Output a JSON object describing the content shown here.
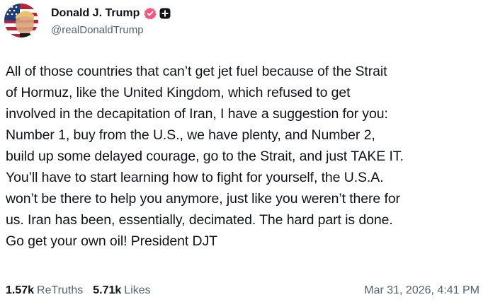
{
  "author": {
    "display_name": "Donald J. Trump",
    "handle": "@realDonaldTrump",
    "avatar_icon": "profile-photo-flag-avatar",
    "verified_icon": "verified-badge-icon",
    "verified_color": "#f6547c",
    "plus_icon": "plus-badge-icon"
  },
  "post": {
    "text": "All of those countries that can’t get jet fuel because of the Strait\nof Hormuz, like the United Kingdom, which refused to get\ninvolved in the decapitation of Iran, I have a suggestion for you:\nNumber 1, buy from the U.S., we have plenty, and Number 2,\nbuild up some delayed courage, go to the Strait, and just TAKE IT.\nYou’ll have to start learning how to fight for yourself, the U.S.A.\nwon’t be there to help you anymore, just like you weren’t there for\nus. Iran has been, essentially, decimated. The hard part is done.\nGo get your own oil! President DJT"
  },
  "stats": {
    "retruths_count": "1.57k",
    "retruths_label": "ReTruths",
    "likes_count": "5.71k",
    "likes_label": "Likes"
  },
  "timestamp": "Mar 31, 2026, 4:41 PM",
  "colors": {
    "text": "#0f1419",
    "muted": "#536471",
    "background": "#ffffff"
  }
}
